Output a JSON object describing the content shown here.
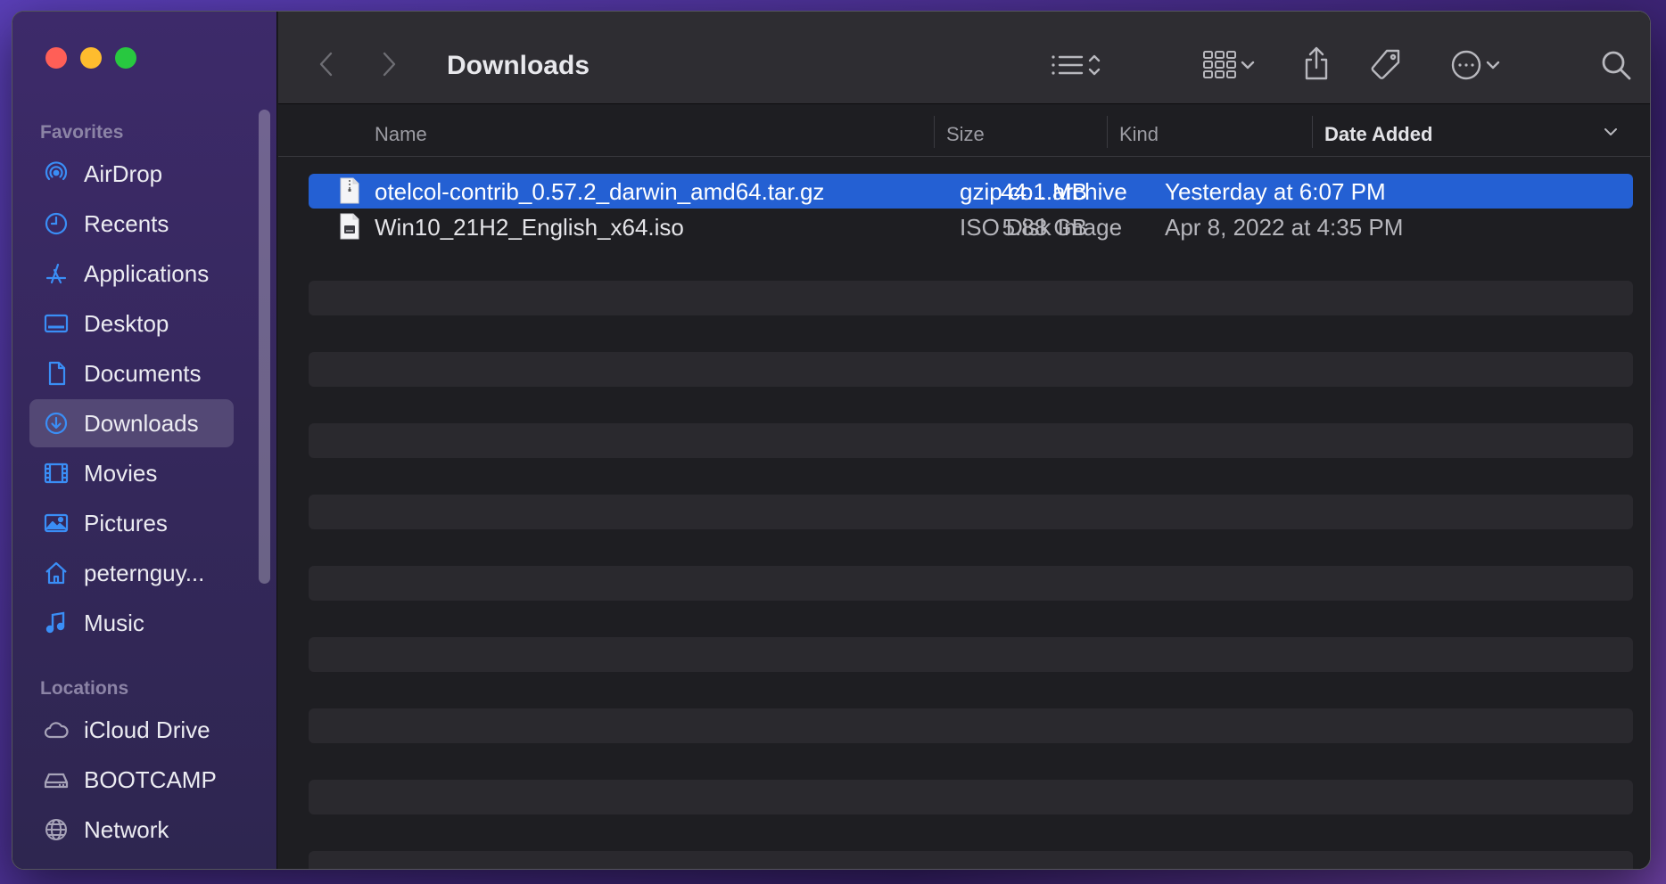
{
  "window": {
    "title": "Downloads"
  },
  "sidebar": {
    "favorites_title": "Favorites",
    "favorites": [
      {
        "label": "AirDrop",
        "icon": "airdrop-icon"
      },
      {
        "label": "Recents",
        "icon": "clock-icon"
      },
      {
        "label": "Applications",
        "icon": "applications-icon"
      },
      {
        "label": "Desktop",
        "icon": "desktop-icon"
      },
      {
        "label": "Documents",
        "icon": "document-icon"
      },
      {
        "label": "Downloads",
        "icon": "download-icon",
        "selected": true
      },
      {
        "label": "Movies",
        "icon": "film-icon"
      },
      {
        "label": "Pictures",
        "icon": "photo-icon"
      },
      {
        "label": "peternguy...",
        "icon": "home-icon"
      },
      {
        "label": "Music",
        "icon": "music-note-icon"
      }
    ],
    "locations_title": "Locations",
    "locations": [
      {
        "label": "iCloud Drive",
        "icon": "cloud-icon"
      },
      {
        "label": "BOOTCAMP",
        "icon": "disk-icon"
      },
      {
        "label": "Network",
        "icon": "globe-icon"
      }
    ]
  },
  "columns": {
    "name": "Name",
    "size": "Size",
    "kind": "Kind",
    "date_added": "Date Added"
  },
  "files": [
    {
      "name": "otelcol-contrib_0.57.2_darwin_amd64.tar.gz",
      "size": "44.1 MB",
      "kind": "gzip co...archive",
      "date_added": "Yesterday at 6:07 PM",
      "selected": true
    },
    {
      "name": "Win10_21H2_English_x64.iso",
      "size": "5.88 GB",
      "kind": "ISO Disk Image",
      "date_added": "Apr 8, 2022 at 4:35 PM",
      "selected": false
    }
  ],
  "colors": {
    "selection": "#2460d3",
    "sidebar_icon": "#3a8ef6",
    "traffic_red": "#ff5f57",
    "traffic_yellow": "#febc2e",
    "traffic_green": "#28c840"
  }
}
